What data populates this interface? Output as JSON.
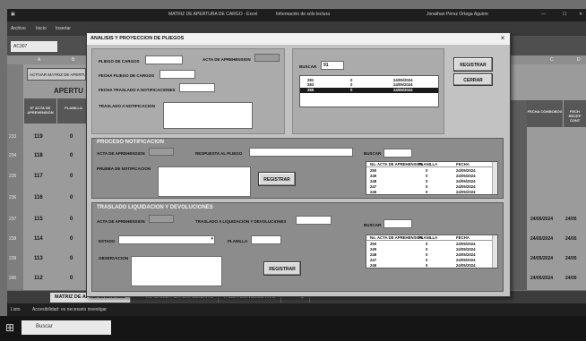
{
  "excel": {
    "title": "MATRIZ DE APERTURA DE CARGO - Excel",
    "title_mid": "Información de sólo lectura",
    "user": "Jonathan Pérez Ortega Aguirre",
    "ribbon": [
      "Archivo",
      "Inicio",
      "Insertar"
    ],
    "name_box": "AC307",
    "col_headers": [
      "A",
      "B",
      "C",
      "D"
    ],
    "macro_button": "ACTIVAR MATRIZ DE APERTURA",
    "sheet_heading": "APERTU",
    "header_1": "Nº ACTA DE APREHENSIÓN",
    "header_2": "PLANILLA",
    "row_numbers": [
      "233",
      "234",
      "235",
      "236",
      "237",
      "238",
      "239",
      "240",
      "241",
      "242"
    ],
    "col_values": [
      "119",
      "118",
      "117",
      "116",
      "115",
      "114",
      "113",
      "112"
    ],
    "col_zero": "0",
    "right_header_1": "FECHA COMBOBOX",
    "right_header_2": "FECH RECEP CONT",
    "right_dates": [
      "24/05/2024",
      "24/05/2024",
      "24/05/2024",
      "24/05/2024"
    ],
    "right_dates_short": [
      "24/05",
      "24/05",
      "24/05",
      "24/05"
    ],
    "sheet_tabs": [
      "MATRIZ DE APREHENSIONES",
      "INFORME POR EXPEDIENTE",
      "TABLA CONSECUTIVO"
    ],
    "status_left": "Listo",
    "status_acc": "Accesibilidad: es necesario investigar",
    "taskbar_search": "Buscar"
  },
  "dialog": {
    "title": "ANALISIS Y PROYECCION DE PLIEGOS",
    "close": "×",
    "top": {
      "labels": {
        "pliego": "PLIEGO DE CARGOS",
        "acta": "ACTA DE APREHENSION",
        "fecha_pliego": "FECHA PLIEGO DE CARGOS",
        "fecha_traslado": "FECHA TRASLADO A NOTIFICACIONES",
        "traslado": "TRASLADO A NOTIFICACION"
      },
      "buscar_label": "BUSCAR",
      "buscar_value": "91",
      "list_rows": [
        [
          "281",
          "0",
          "24/05/2024"
        ],
        [
          "283",
          "0",
          "24/05/2024"
        ],
        [
          "285",
          "0",
          "24/05/2024"
        ]
      ],
      "registrar": "REGISTRAR",
      "cerrar": "CERRAR"
    },
    "notificacion": {
      "title": "PROCESO NOTIFICACION",
      "acta_label": "ACTA DE APREHENSION",
      "respuesta_label": "RESPUESTA AL PLIEGO",
      "buscar_label": "BUSCAR",
      "prueba_label": "PRUEBA DE NOTIFICACION",
      "registrar": "REGISTRAR",
      "list_header": [
        "No. ACTA DE APREHENSION",
        "PLANILLA",
        "FECHA"
      ],
      "list_rows": [
        [
          "250",
          "0",
          "24/05/2024"
        ],
        [
          "249",
          "0",
          "24/05/2024"
        ],
        [
          "248",
          "0",
          "24/05/2024"
        ],
        [
          "247",
          "0",
          "24/05/2024"
        ],
        [
          "246",
          "0",
          "24/05/2024"
        ]
      ]
    },
    "liquidacion": {
      "title": "TRASLADO LIQUIDACION Y DEVOLUCIONES",
      "acta_label": "ACTA DE APREHENSION",
      "traslado_label": "TRASLADO A LIQUIDACION Y DEVOLUCIONES",
      "buscar_label": "BUSCAR",
      "estado_label": "ESTADO",
      "planilla_label": "PLANILLA",
      "observacion_label": "OBSERVACION",
      "registrar": "REGISTRAR",
      "list_header": [
        "No. ACTA DE APREHENSION",
        "PLANILLA",
        "FECHA"
      ],
      "list_rows": [
        [
          "250",
          "0",
          "24/05/2024"
        ],
        [
          "249",
          "0",
          "24/05/2024"
        ],
        [
          "248",
          "0",
          "24/05/2024"
        ],
        [
          "247",
          "0",
          "24/05/2024"
        ],
        [
          "246",
          "0",
          "24/05/2024"
        ]
      ]
    }
  }
}
